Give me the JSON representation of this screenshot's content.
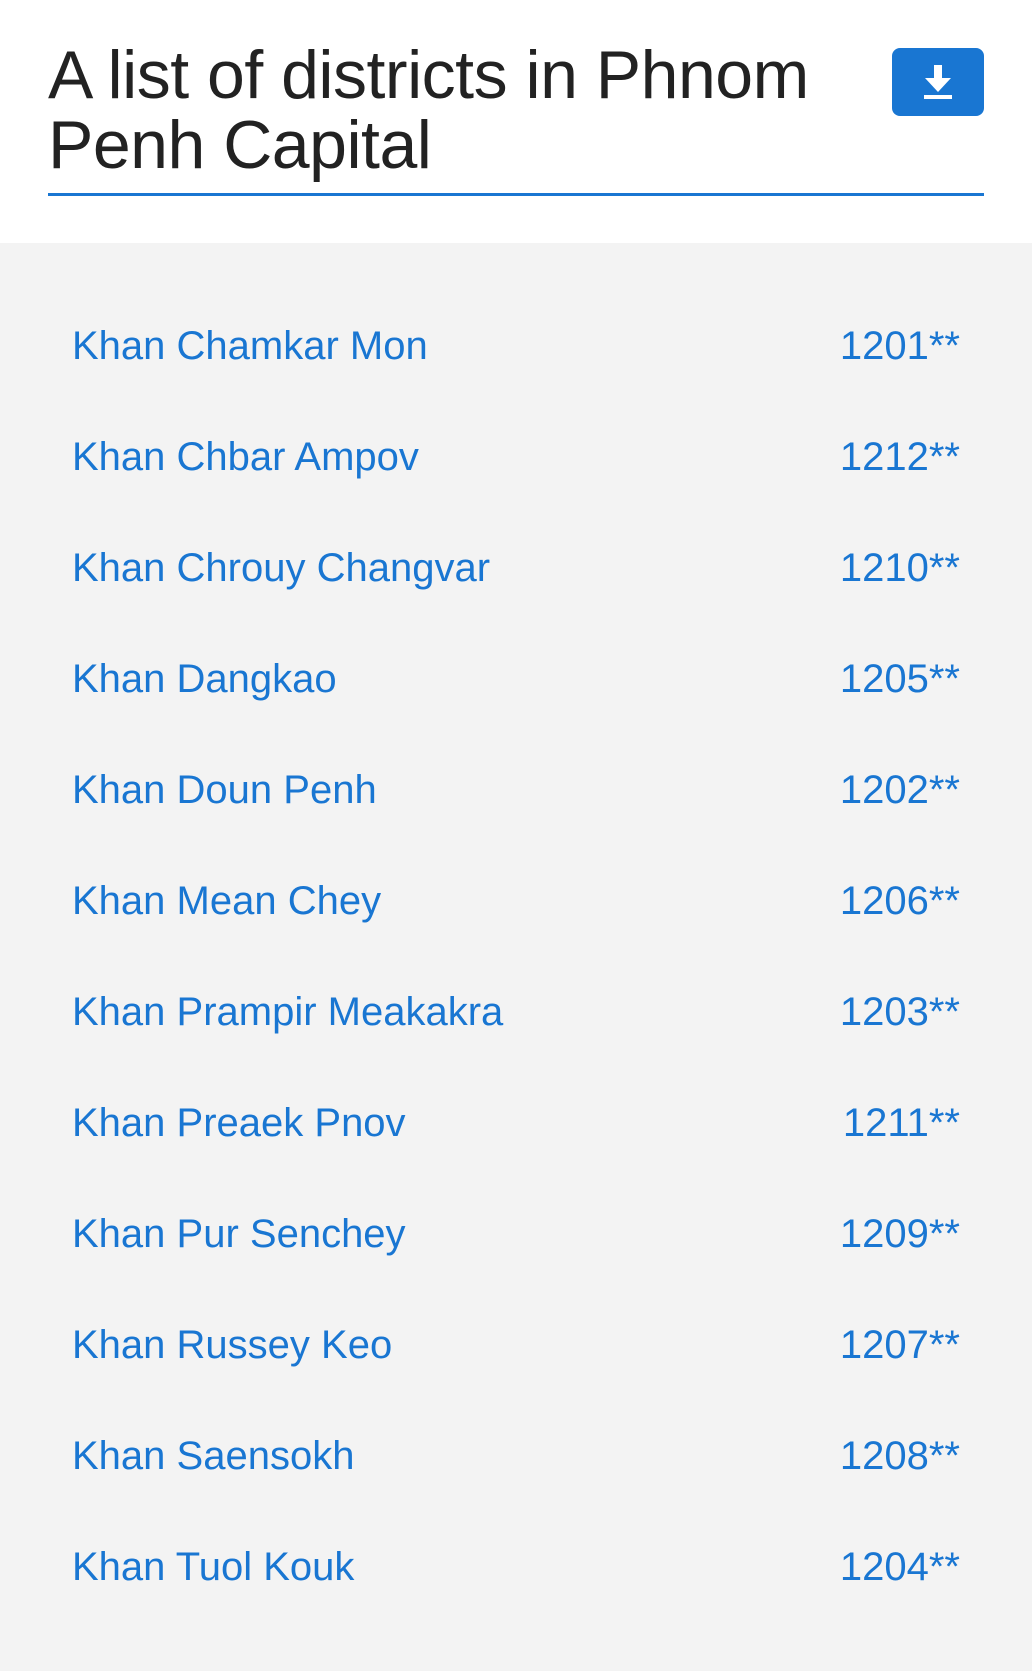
{
  "header": {
    "title": "A list of districts in Phnom Penh Capital",
    "download_icon": "download-icon"
  },
  "colors": {
    "accent": "#1976d2",
    "title_text": "#222222",
    "panel_background": "#f3f3f3",
    "page_background": "#ffffff"
  },
  "districts": [
    {
      "name": "Khan Chamkar Mon",
      "code": "1201**"
    },
    {
      "name": "Khan Chbar Ampov",
      "code": "1212**"
    },
    {
      "name": "Khan Chrouy Changvar",
      "code": "1210**"
    },
    {
      "name": "Khan Dangkao",
      "code": "1205**"
    },
    {
      "name": "Khan Doun Penh",
      "code": "1202**"
    },
    {
      "name": "Khan Mean Chey",
      "code": "1206**"
    },
    {
      "name": "Khan Prampir Meakakra",
      "code": "1203**"
    },
    {
      "name": "Khan Preaek Pnov",
      "code": "1211**"
    },
    {
      "name": "Khan Pur Senchey",
      "code": "1209**"
    },
    {
      "name": "Khan Russey Keo",
      "code": "1207**"
    },
    {
      "name": "Khan Saensokh",
      "code": "1208**"
    },
    {
      "name": "Khan Tuol Kouk",
      "code": "1204**"
    }
  ]
}
